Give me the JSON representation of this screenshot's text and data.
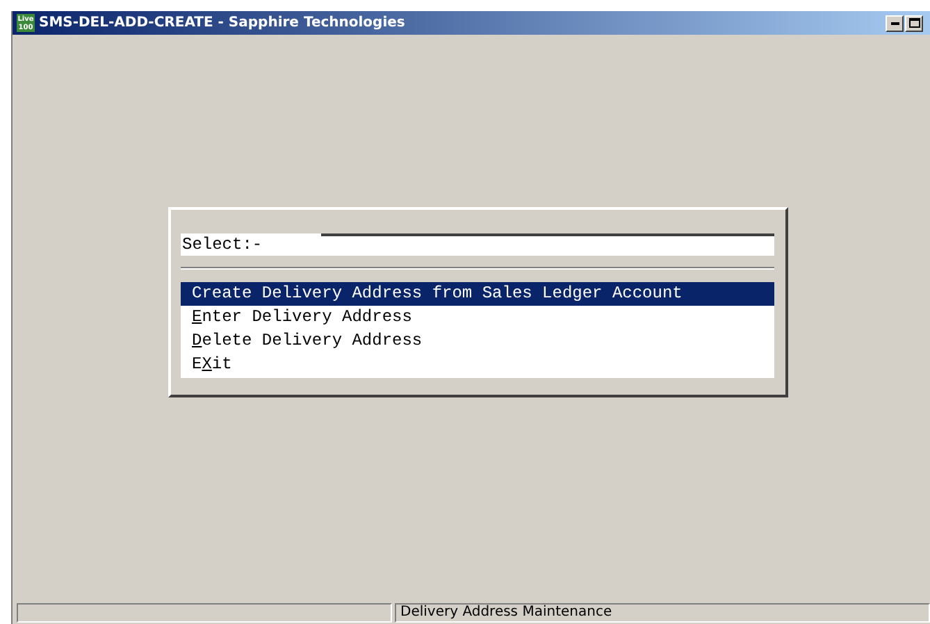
{
  "window": {
    "title": "SMS-DEL-ADD-CREATE - Sapphire Technologies",
    "app_icon_text": "Live 100"
  },
  "prompt": {
    "label": "Select:-"
  },
  "menu": [
    {
      "label": "Create Delivery Address from Sales Ledger Account",
      "selected": true
    },
    {
      "label": {
        "key": "E",
        "after": "nter Delivery Address"
      },
      "selected": false
    },
    {
      "label": {
        "key": "D",
        "after": "elete Delivery Address"
      },
      "selected": false
    },
    {
      "label": {
        "before": "E",
        "key": "X",
        "after": "it"
      },
      "selected": false
    }
  ],
  "status_bar": {
    "panel_2": "Delivery Address Maintenance"
  }
}
